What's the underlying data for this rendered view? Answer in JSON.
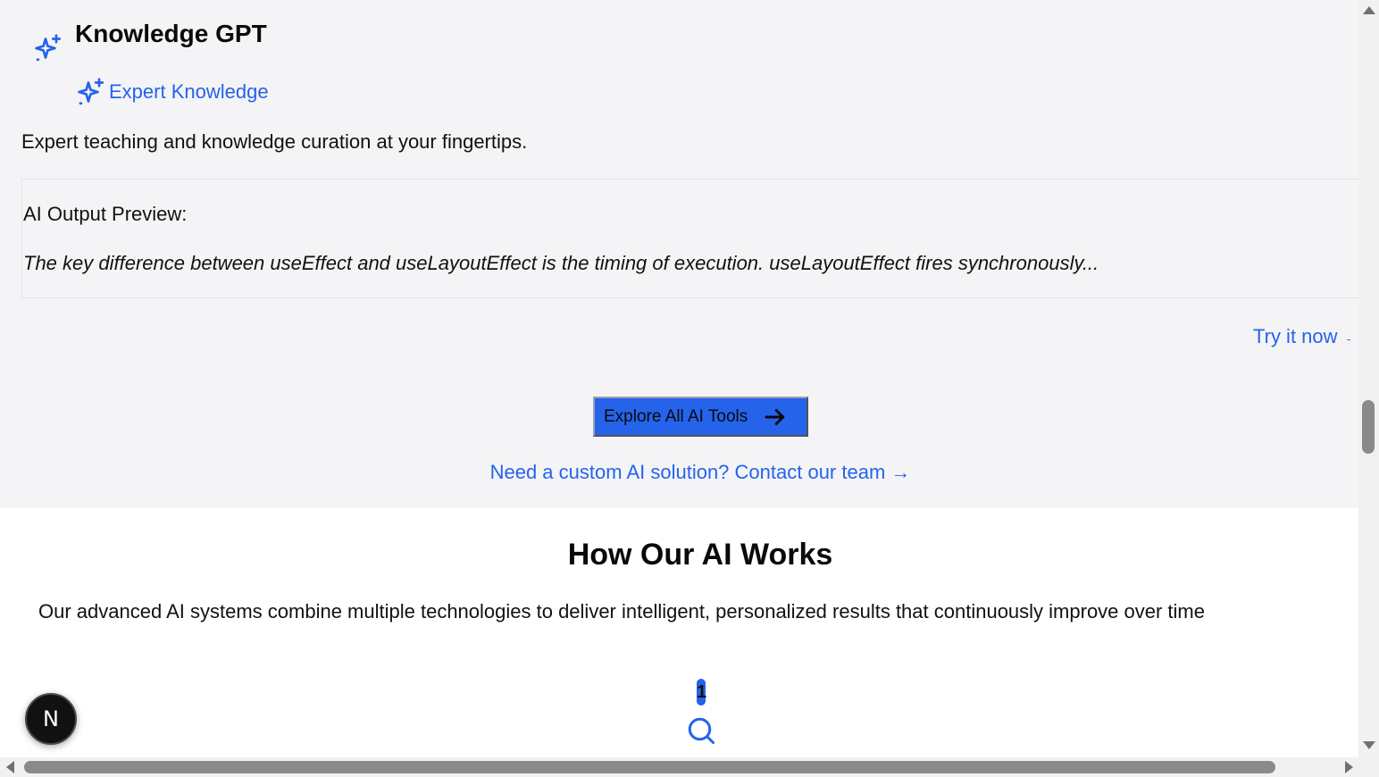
{
  "card": {
    "title": "Knowledge GPT",
    "title_icon": "sparkles-icon",
    "badge_icon": "sparkles-icon",
    "badge_label": "Expert Knowledge",
    "description": "Expert teaching and knowledge curation at your fingertips.",
    "preview_label": "AI Output Preview:",
    "preview_text": "The key difference between useEffect and useLayoutEffect is the timing of execution. useLayoutEffect fires synchronously...",
    "try_label": "Try it now",
    "try_arrow": "→"
  },
  "cta": {
    "explore_label": "Explore All AI Tools",
    "explore_icon": "arrow-right-icon",
    "contact_label": "Need a custom AI solution? Contact our team →"
  },
  "how": {
    "title": "How Our AI Works",
    "description": "Our advanced AI systems combine multiple technologies to deliver intelligent, personalized results that continuously improve over time",
    "steps": [
      {
        "number": "1",
        "icon": "search-icon"
      }
    ]
  },
  "dev_badge": {
    "letter": "N",
    "icon": "nextjs-icon"
  },
  "colors": {
    "accent": "#2563eb",
    "gray_bg": "#f4f4f6",
    "text": "#111111"
  }
}
